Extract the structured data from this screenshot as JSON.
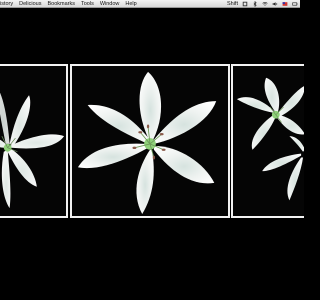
{
  "menubar": {
    "items": [
      "istory",
      "Delicious",
      "Bookmarks",
      "Tools",
      "Window",
      "Help"
    ],
    "user_label": "Shift",
    "status_icons": [
      "app-icon",
      "bluetooth-icon",
      "wifi-icon",
      "volume-icon",
      "flag-icon",
      "battery-icon"
    ]
  },
  "photos": [
    {
      "subject": "white lily flower, left crop"
    },
    {
      "subject": "white lily flower, centered"
    },
    {
      "subject": "two white lily flowers, right crop"
    }
  ],
  "colors": {
    "background": "#000000",
    "petal": "#f3f4f2",
    "petal_shade": "#cfd8d6",
    "stamen": "#8a5a4a",
    "center": "#8fd17a"
  }
}
